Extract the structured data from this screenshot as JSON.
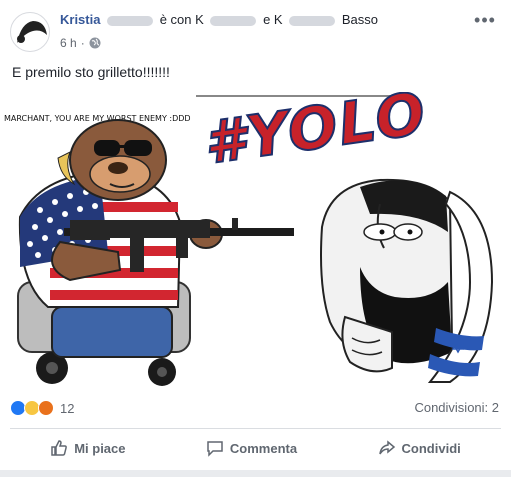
{
  "post": {
    "author": "Kristia",
    "with_text": "è con K",
    "and_text": "e K",
    "trailing": "Basso",
    "time": "6 h",
    "privacy_icon": "globe-icon",
    "more_icon": "more-options-icon",
    "text": "E premilo sto grilletto!!!!!!!"
  },
  "meme": {
    "caption": "MARCHANT, YOU ARE MY WORST ENEMY :DDD",
    "title": "#YOLO"
  },
  "stats": {
    "reaction_icons": [
      "like-reaction-icon",
      "haha-reaction-icon",
      "angry-reaction-icon"
    ],
    "reaction_count": "12",
    "shares": "Condivisioni: 2"
  },
  "actions": {
    "like": "Mi piace",
    "comment": "Commenta",
    "share": "Condividi"
  },
  "colors": {
    "link": "#365899",
    "secondary_text": "#616770",
    "background": "#e9ebee",
    "like_blue": "#2078f4"
  }
}
